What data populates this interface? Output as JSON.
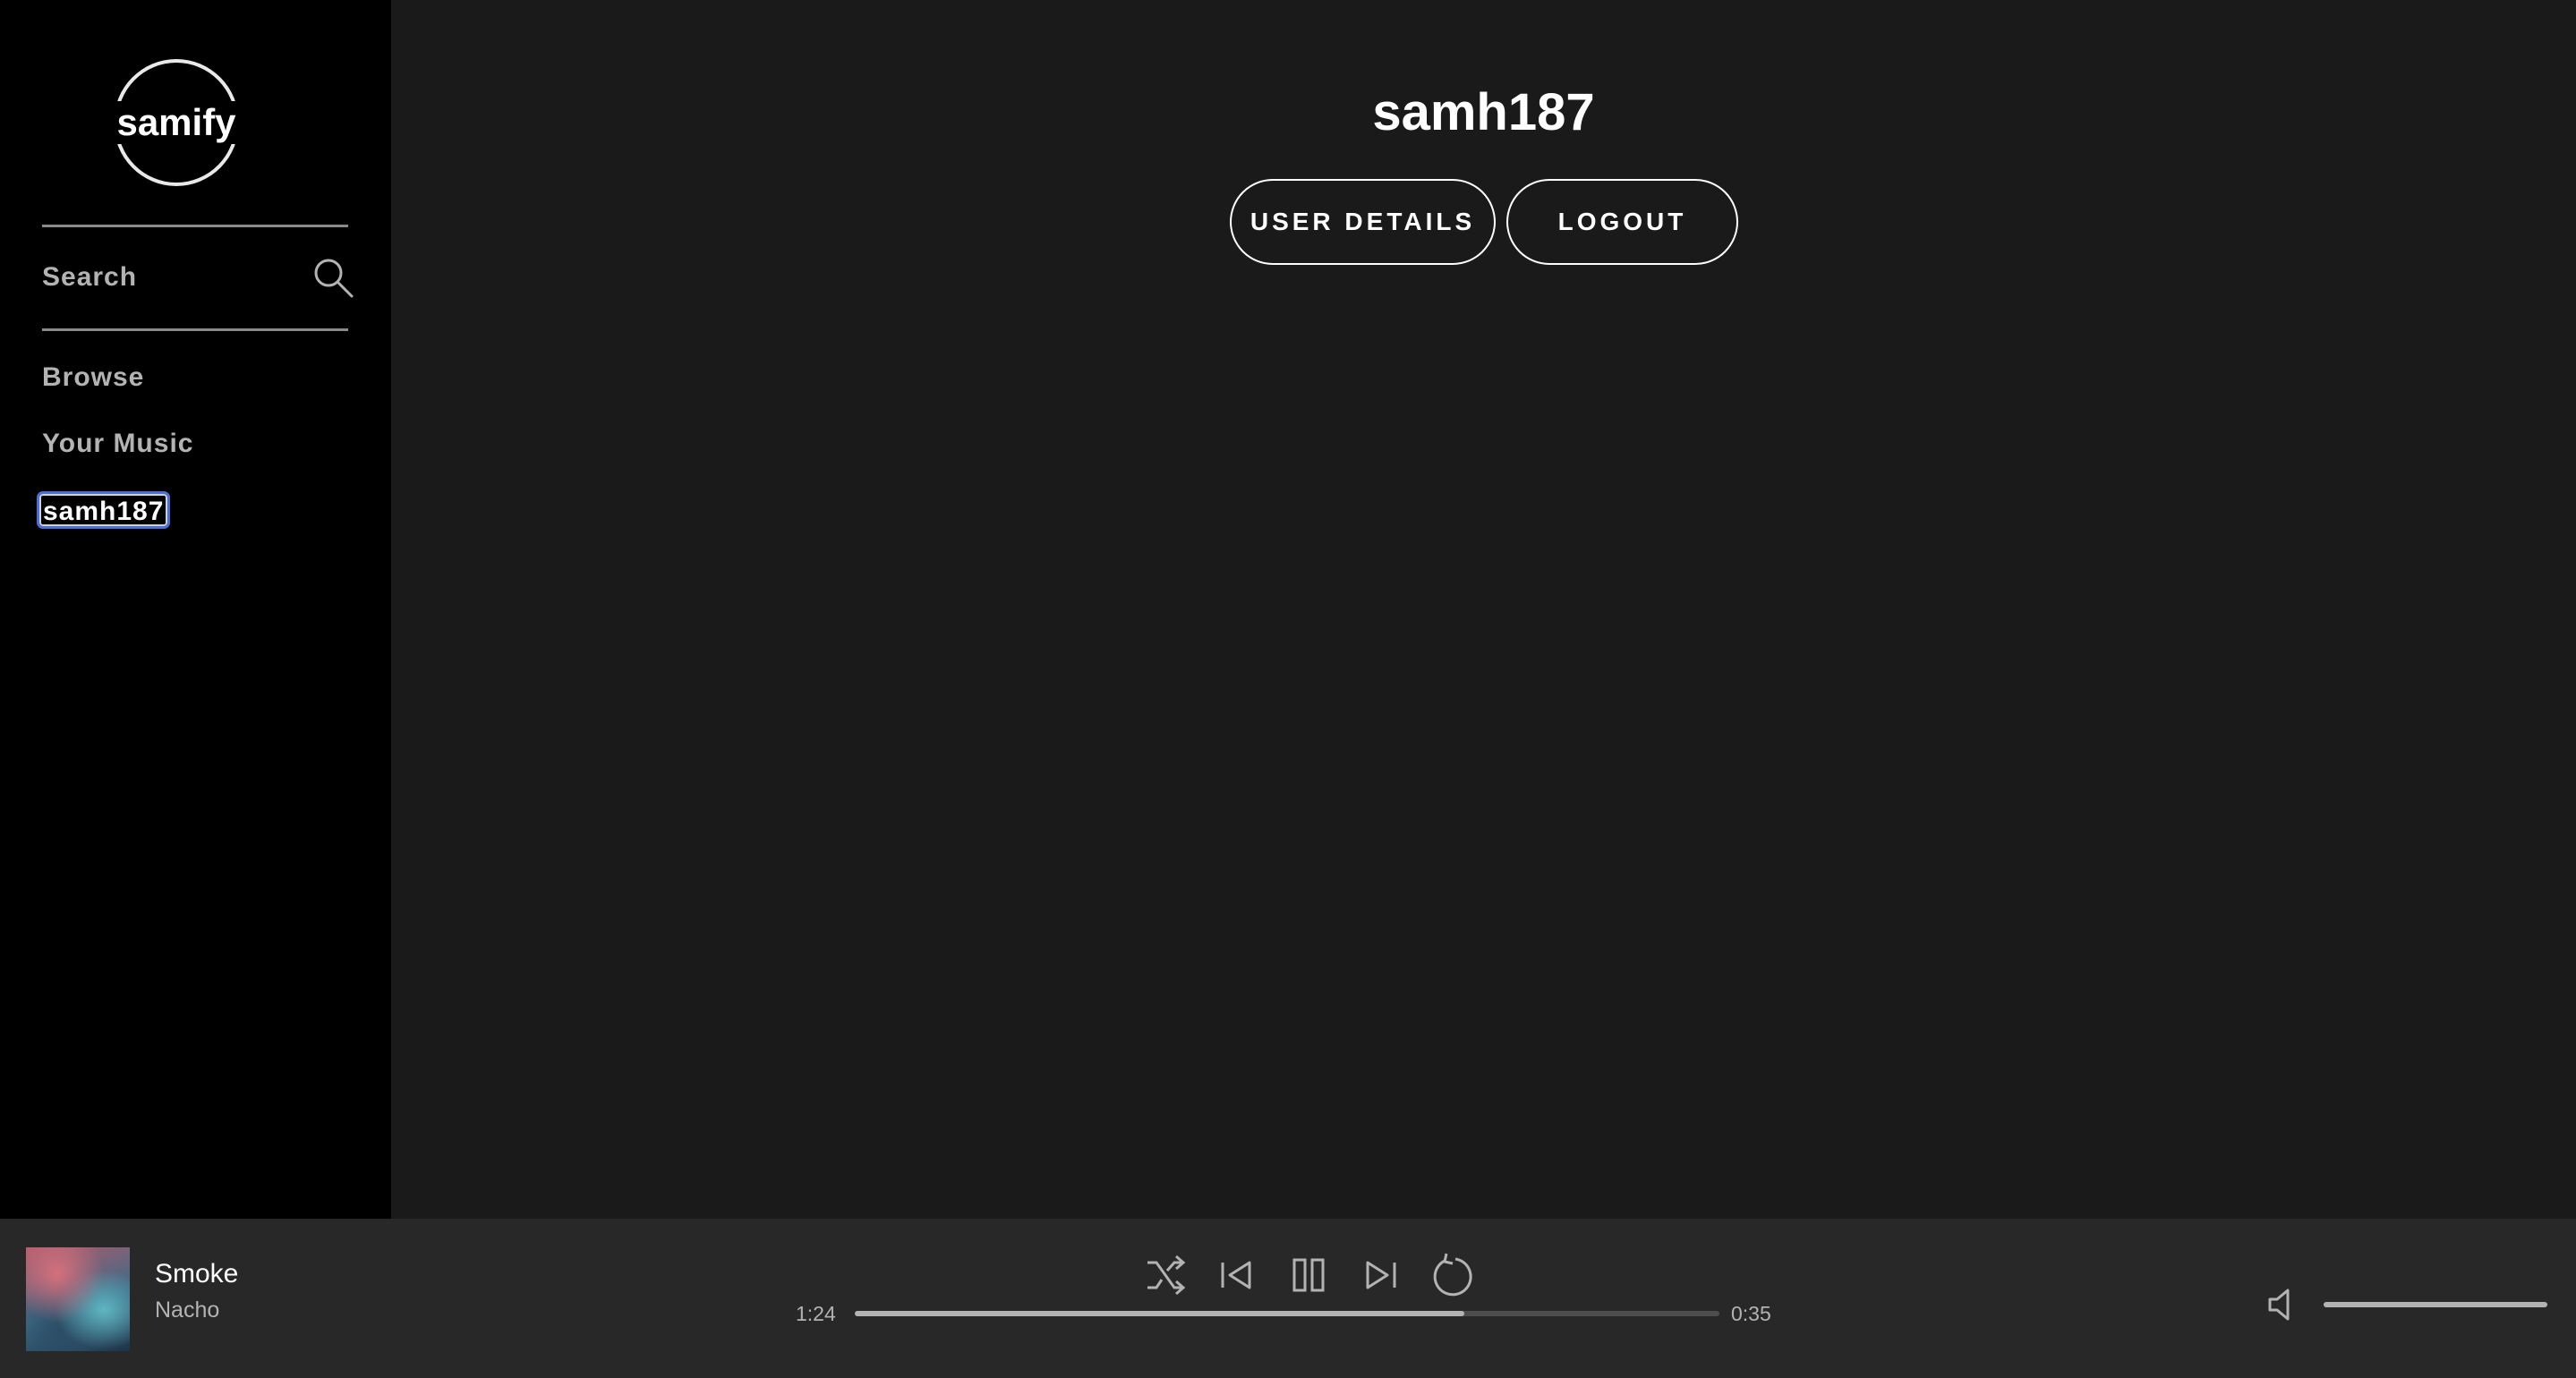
{
  "sidebar": {
    "logo_text": "samify",
    "search_label": "Search",
    "nav": [
      {
        "label": "Browse"
      },
      {
        "label": "Your Music"
      },
      {
        "label": "samh187"
      }
    ]
  },
  "profile": {
    "username": "samh187",
    "buttons": {
      "user_details": "USER DETAILS",
      "logout": "LOGOUT"
    }
  },
  "player": {
    "track_title": "Smoke",
    "artist": "Nacho",
    "elapsed": "1:24",
    "remaining": "0:35",
    "progress_fraction": 0.705,
    "volume_fraction": 1.0,
    "controls": [
      "shuffle-icon",
      "previous-icon",
      "pause-icon",
      "next-icon",
      "repeat-icon"
    ]
  },
  "colors": {
    "sidebar_bg": "#000000",
    "main_bg": "#1a1a1a",
    "player_bg": "#282828",
    "muted_text": "#b3b3b3",
    "focus_outline": "#4a6fd8"
  }
}
